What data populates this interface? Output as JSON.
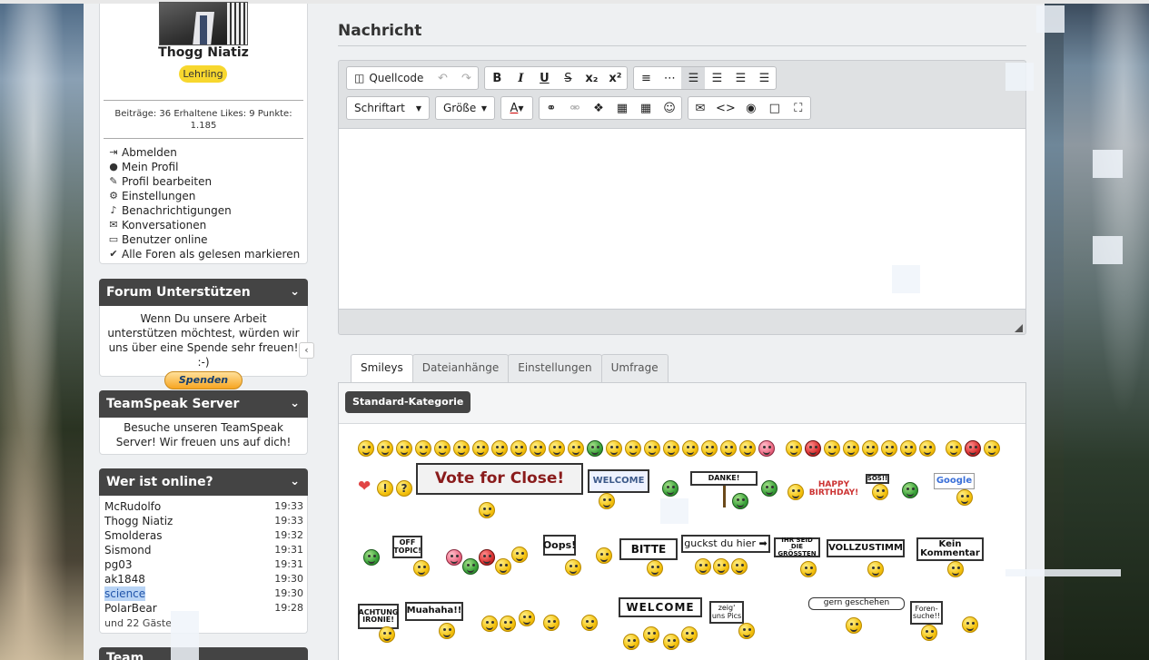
{
  "user": {
    "name": "Thogg Niatiz",
    "rank": "Lehrling",
    "stats": "Beiträge: 36  Erhaltene Likes: 9  Punkte: 1.185"
  },
  "user_menu": [
    {
      "icon": "sign-out-icon",
      "glyph": "⇥",
      "label": "Abmelden"
    },
    {
      "icon": "user-icon",
      "glyph": "●",
      "label": "Mein Profil"
    },
    {
      "icon": "wrench-icon",
      "glyph": "✎",
      "label": "Profil bearbeiten"
    },
    {
      "icon": "gear-icon",
      "glyph": "⚙",
      "label": "Einstellungen"
    },
    {
      "icon": "bell-icon",
      "glyph": "♪",
      "label": "Benachrichtigungen"
    },
    {
      "icon": "chat-icon",
      "glyph": "✉",
      "label": "Konversationen"
    },
    {
      "icon": "monitor-icon",
      "glyph": "▭",
      "label": "Benutzer online"
    },
    {
      "icon": "check-icon",
      "glyph": "✔",
      "label": "Alle Foren als gelesen markieren"
    }
  ],
  "support": {
    "title": "Forum Unterstützen",
    "text": "Wenn Du unsere Arbeit unterstützen möchtest, würden wir uns über eine Spende sehr freuen! :-)",
    "button": "Spenden"
  },
  "teamspeak": {
    "title": "TeamSpeak Server",
    "text": "Besuche unseren TeamSpeak Server! Wir freuen uns auf dich!"
  },
  "online": {
    "title": "Wer ist online?",
    "users": [
      {
        "name": "McRudolfo",
        "time": "19:33"
      },
      {
        "name": "Thogg Niatiz",
        "time": "19:33"
      },
      {
        "name": "Smolderas",
        "time": "19:32"
      },
      {
        "name": "Sismond",
        "time": "19:31"
      },
      {
        "name": "pg03",
        "time": "19:31"
      },
      {
        "name": "ak1848",
        "time": "19:30"
      },
      {
        "name": "science",
        "time": "19:30"
      },
      {
        "name": "PolarBear",
        "time": "19:28"
      }
    ],
    "guests": "und 22 Gäste"
  },
  "team": {
    "title": "Team"
  },
  "main": {
    "title": "Nachricht",
    "toolbar": {
      "source_label": "Quellcode",
      "bold": "B",
      "italic": "I",
      "underline": "U",
      "strike": "S",
      "subscript": "x₂",
      "superscript": "x²",
      "font_label": "Schriftart",
      "size_label": "Größe",
      "color_label": "A"
    },
    "tabs": [
      "Smileys",
      "Dateianhänge",
      "Einstellungen",
      "Umfrage"
    ],
    "category_button": "Standard-Kategorie"
  },
  "smiley_signs": {
    "vote": "Vote for Close!",
    "welcome_small": "WELCOME",
    "danke": "DANKE!",
    "birthday": "HAPPY BIRTHDAY!",
    "sos": "SOS!!",
    "google": "Google",
    "offtopic": "OFF TOPIC!",
    "oops": "Oops!",
    "bitte": "BITTE",
    "guckst": "guckst du hier ➡",
    "groessten": "IHR SEID DIE GRÖSSTEN",
    "vollzustimm": "VOLLZUSTIMM",
    "kein_kommentar": "Kein Kommentar",
    "achtung": "ACHTUNG IRONIE!",
    "muahaha": "Muahaha!!",
    "welcome_big": "WELCOME",
    "zeigt": "zeig' uns Pics",
    "gern": "gern geschehen",
    "forensuche": "Foren-suche!!"
  },
  "colors": {
    "panel_header": "#444444",
    "rank_badge": "#f7d72e",
    "highlight": "#b9d4f5"
  }
}
